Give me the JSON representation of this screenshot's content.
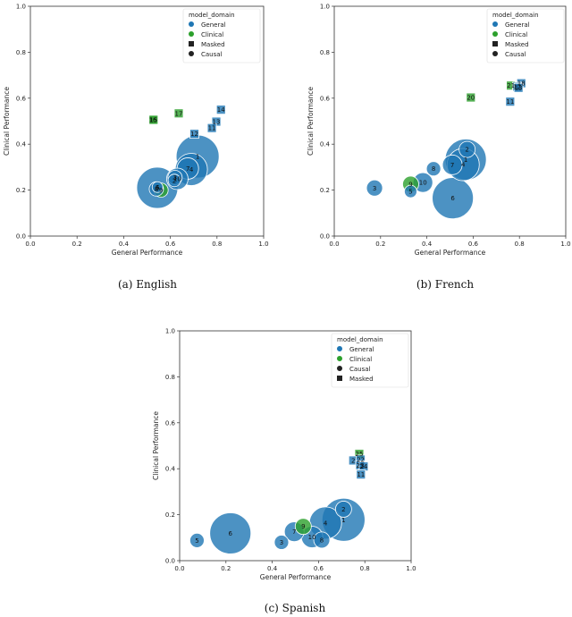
{
  "colors": {
    "General": "#1f77b4",
    "Clinical": "#2ca02c",
    "marker": "#222222"
  },
  "chart_data": [
    {
      "type": "scatter",
      "caption": "(a) English",
      "xlabel": "General Performance",
      "ylabel": "Clinical Performance",
      "xlim": [
        0,
        1
      ],
      "ylim": [
        0,
        1
      ],
      "xticks": [
        "0.0",
        "0.2",
        "0.4",
        "0.6",
        "0.8",
        "1.0"
      ],
      "yticks": [
        "0.0",
        "0.2",
        "0.4",
        "0.6",
        "0.8",
        "1.0"
      ],
      "grid": false,
      "legend": {
        "position": "top-right",
        "title": "model_domain",
        "entries": [
          {
            "label": "General",
            "marker": "circle",
            "domain": "General"
          },
          {
            "label": "Clinical",
            "marker": "circle",
            "domain": "Clinical"
          },
          {
            "label": "Masked",
            "marker": "square",
            "domain": null
          },
          {
            "label": "Causal",
            "marker": "circle",
            "domain": null
          }
        ]
      },
      "points": [
        {
          "label": "1",
          "x": 0.717,
          "y": 0.346,
          "domain": "General",
          "type": "Causal",
          "size": 24
        },
        {
          "label": "5",
          "x": 0.544,
          "y": 0.21,
          "domain": "General",
          "type": "Causal",
          "size": 23
        },
        {
          "label": "4",
          "x": 0.69,
          "y": 0.29,
          "domain": "General",
          "type": "Causal",
          "size": 18
        },
        {
          "label": "7",
          "x": 0.675,
          "y": 0.294,
          "domain": "General",
          "type": "Causal",
          "size": 12
        },
        {
          "label": "10",
          "x": 0.63,
          "y": 0.249,
          "domain": "General",
          "type": "Causal",
          "size": 12
        },
        {
          "label": "3",
          "x": 0.62,
          "y": 0.255,
          "domain": "General",
          "type": "Causal",
          "size": 8
        },
        {
          "label": "2",
          "x": 0.617,
          "y": 0.242,
          "domain": "General",
          "type": "Causal",
          "size": 7
        },
        {
          "label": "9",
          "x": 0.56,
          "y": 0.2,
          "domain": "Clinical",
          "type": "Causal",
          "size": 8
        },
        {
          "label": "8",
          "x": 0.54,
          "y": 0.205,
          "domain": "General",
          "type": "Causal",
          "size": 8
        },
        {
          "label": "6",
          "x": 0.545,
          "y": 0.213,
          "domain": "General",
          "type": "Causal",
          "size": 6
        },
        {
          "label": "16",
          "x": 0.525,
          "y": 0.506,
          "domain": "Clinical",
          "type": "Masked",
          "size": 5
        },
        {
          "label": "15",
          "x": 0.528,
          "y": 0.506,
          "domain": "Clinical",
          "type": "Masked",
          "size": 5
        },
        {
          "label": "17",
          "x": 0.636,
          "y": 0.534,
          "domain": "Clinical",
          "type": "Masked",
          "size": 5
        },
        {
          "label": "14",
          "x": 0.817,
          "y": 0.55,
          "domain": "General",
          "type": "Masked",
          "size": 5
        },
        {
          "label": "13",
          "x": 0.797,
          "y": 0.498,
          "domain": "General",
          "type": "Masked",
          "size": 5
        },
        {
          "label": "11",
          "x": 0.778,
          "y": 0.47,
          "domain": "General",
          "type": "Masked",
          "size": 5
        },
        {
          "label": "12",
          "x": 0.703,
          "y": 0.445,
          "domain": "General",
          "type": "Masked",
          "size": 5
        }
      ]
    },
    {
      "type": "scatter",
      "caption": "(b) French",
      "xlabel": "General Performance",
      "ylabel": "Clinical Performance",
      "xlim": [
        0,
        1
      ],
      "ylim": [
        0,
        1
      ],
      "xticks": [
        "0.0",
        "0.2",
        "0.4",
        "0.6",
        "0.8",
        "1.0"
      ],
      "yticks": [
        "0.0",
        "0.2",
        "0.4",
        "0.6",
        "0.8",
        "1.0"
      ],
      "grid": false,
      "legend": {
        "position": "top-right",
        "title": "model_domain",
        "entries": [
          {
            "label": "General",
            "marker": "circle",
            "domain": "General"
          },
          {
            "label": "Clinical",
            "marker": "circle",
            "domain": "Clinical"
          },
          {
            "label": "Masked",
            "marker": "square",
            "domain": null
          },
          {
            "label": "Causal",
            "marker": "circle",
            "domain": null
          }
        ]
      },
      "points": [
        {
          "label": "1",
          "x": 0.568,
          "y": 0.333,
          "domain": "General",
          "type": "Causal",
          "size": 23
        },
        {
          "label": "6",
          "x": 0.512,
          "y": 0.165,
          "domain": "General",
          "type": "Causal",
          "size": 23
        },
        {
          "label": "4",
          "x": 0.557,
          "y": 0.311,
          "domain": "General",
          "type": "Causal",
          "size": 18
        },
        {
          "label": "7",
          "x": 0.51,
          "y": 0.31,
          "domain": "General",
          "type": "Causal",
          "size": 11
        },
        {
          "label": "2",
          "x": 0.574,
          "y": 0.377,
          "domain": "General",
          "type": "Causal",
          "size": 9
        },
        {
          "label": "8",
          "x": 0.429,
          "y": 0.293,
          "domain": "General",
          "type": "Causal",
          "size": 8
        },
        {
          "label": "10",
          "x": 0.383,
          "y": 0.233,
          "domain": "General",
          "type": "Causal",
          "size": 11
        },
        {
          "label": "9",
          "x": 0.33,
          "y": 0.226,
          "domain": "Clinical",
          "type": "Causal",
          "size": 9
        },
        {
          "label": "5",
          "x": 0.33,
          "y": 0.194,
          "domain": "General",
          "type": "Causal",
          "size": 7
        },
        {
          "label": "3",
          "x": 0.174,
          "y": 0.209,
          "domain": "General",
          "type": "Causal",
          "size": 9
        },
        {
          "label": "20",
          "x": 0.59,
          "y": 0.603,
          "domain": "Clinical",
          "type": "Masked",
          "size": 5
        },
        {
          "label": "21",
          "x": 0.763,
          "y": 0.655,
          "domain": "Clinical",
          "type": "Masked",
          "size": 5
        },
        {
          "label": "18",
          "x": 0.808,
          "y": 0.665,
          "domain": "General",
          "type": "Masked",
          "size": 5
        },
        {
          "label": "12",
          "x": 0.79,
          "y": 0.65,
          "domain": "General",
          "type": "Masked",
          "size": 5
        },
        {
          "label": "13",
          "x": 0.796,
          "y": 0.645,
          "domain": "General",
          "type": "Masked",
          "size": 5
        },
        {
          "label": "11",
          "x": 0.76,
          "y": 0.585,
          "domain": "General",
          "type": "Masked",
          "size": 5
        }
      ]
    },
    {
      "type": "scatter",
      "caption": "(c) Spanish",
      "xlabel": "General Performance",
      "ylabel": "Clinical Performance",
      "xlim": [
        0,
        1
      ],
      "ylim": [
        0,
        1
      ],
      "xticks": [
        "0.0",
        "0.2",
        "0.4",
        "0.6",
        "0.8",
        "1.0"
      ],
      "yticks": [
        "0.0",
        "0.2",
        "0.4",
        "0.6",
        "0.8",
        "1.0"
      ],
      "grid": false,
      "legend": {
        "position": "top-right",
        "title": "model_domain",
        "entries": [
          {
            "label": "General",
            "marker": "circle",
            "domain": "General"
          },
          {
            "label": "Clinical",
            "marker": "circle",
            "domain": "Clinical"
          },
          {
            "label": "Causal",
            "marker": "circle",
            "domain": null
          },
          {
            "label": "Masked",
            "marker": "square",
            "domain": null
          }
        ]
      },
      "points": [
        {
          "label": "1",
          "x": 0.708,
          "y": 0.178,
          "domain": "General",
          "type": "Causal",
          "size": 24
        },
        {
          "label": "6",
          "x": 0.219,
          "y": 0.119,
          "domain": "General",
          "type": "Causal",
          "size": 23
        },
        {
          "label": "4",
          "x": 0.63,
          "y": 0.164,
          "domain": "General",
          "type": "Causal",
          "size": 18
        },
        {
          "label": "2",
          "x": 0.708,
          "y": 0.224,
          "domain": "General",
          "type": "Causal",
          "size": 9
        },
        {
          "label": "9",
          "x": 0.534,
          "y": 0.149,
          "domain": "Clinical",
          "type": "Causal",
          "size": 9
        },
        {
          "label": "7",
          "x": 0.495,
          "y": 0.126,
          "domain": "General",
          "type": "Causal",
          "size": 11
        },
        {
          "label": "10",
          "x": 0.572,
          "y": 0.103,
          "domain": "General",
          "type": "Causal",
          "size": 12
        },
        {
          "label": "8",
          "x": 0.614,
          "y": 0.09,
          "domain": "General",
          "type": "Causal",
          "size": 9
        },
        {
          "label": "3",
          "x": 0.44,
          "y": 0.08,
          "domain": "General",
          "type": "Causal",
          "size": 8
        },
        {
          "label": "5",
          "x": 0.075,
          "y": 0.088,
          "domain": "General",
          "type": "Causal",
          "size": 8
        },
        {
          "label": "25",
          "x": 0.776,
          "y": 0.465,
          "domain": "Clinical",
          "type": "Masked",
          "size": 5
        },
        {
          "label": "2",
          "x": 0.75,
          "y": 0.436,
          "domain": "General",
          "type": "Masked",
          "size": 5
        },
        {
          "label": "22",
          "x": 0.782,
          "y": 0.44,
          "domain": "General",
          "type": "Masked",
          "size": 5
        },
        {
          "label": "23",
          "x": 0.78,
          "y": 0.415,
          "domain": "General",
          "type": "Masked",
          "size": 5
        },
        {
          "label": "24",
          "x": 0.795,
          "y": 0.41,
          "domain": "General",
          "type": "Masked",
          "size": 5
        },
        {
          "label": "11",
          "x": 0.783,
          "y": 0.375,
          "domain": "General",
          "type": "Masked",
          "size": 5
        }
      ]
    }
  ]
}
